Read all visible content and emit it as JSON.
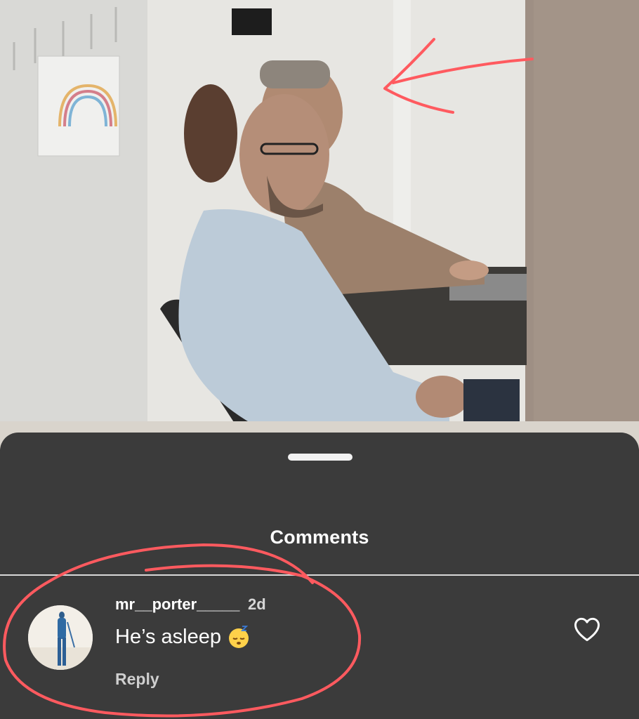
{
  "sheet": {
    "title": "Comments"
  },
  "comment": {
    "username": "mr__porter_____",
    "age": "2d",
    "text": "He’s asleep",
    "emoji": "sleeping-face-emoji",
    "reply_label": "Reply"
  },
  "icons": {
    "heart": "heart-outline-icon"
  },
  "colors": {
    "annotation": "#ff5a5f",
    "sheet_bg": "#3b3b3b"
  }
}
